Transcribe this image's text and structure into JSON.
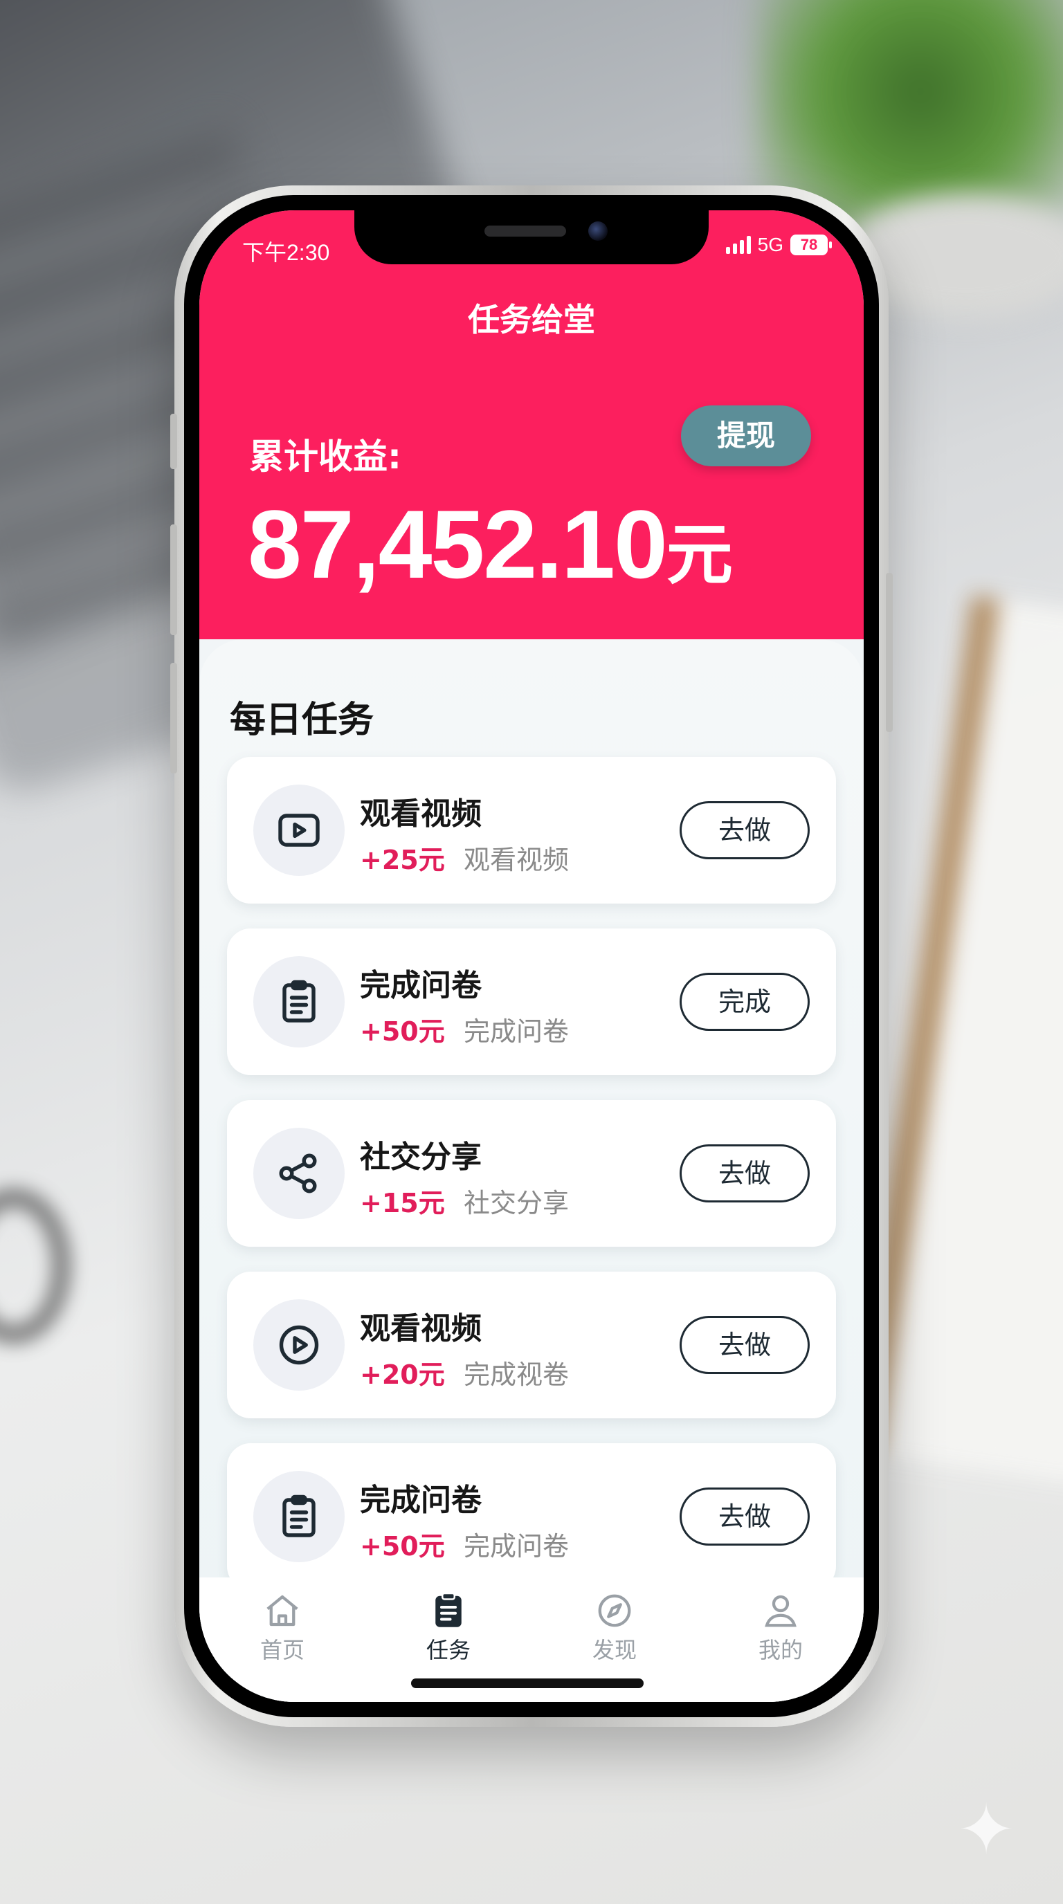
{
  "status_bar": {
    "time": "下午2:30",
    "network": "5G",
    "battery": "78"
  },
  "header": {
    "app_title": "任务给堂",
    "earnings_label": "累计收益:",
    "earnings_value": "87,452.10",
    "earnings_unit": "元",
    "withdraw_label": "提现"
  },
  "section_title": "每日任务",
  "tasks": [
    {
      "icon": "video-icon",
      "title": "观看视频",
      "reward": "+25元",
      "desc": "观看视频",
      "button": "去做"
    },
    {
      "icon": "clipboard-icon",
      "title": "完成问卷",
      "reward": "+50元",
      "desc": "完成问卷",
      "button": "完成"
    },
    {
      "icon": "share-icon",
      "title": "社交分享",
      "reward": "+15元",
      "desc": "社交分享",
      "button": "去做"
    },
    {
      "icon": "play-circle-icon",
      "title": "观看视频",
      "reward": "+20元",
      "desc": "完成视卷",
      "button": "去做"
    },
    {
      "icon": "clipboard-icon",
      "title": "完成问卷",
      "reward": "+50元",
      "desc": "完成问卷",
      "button": "去做"
    }
  ],
  "tabbar": {
    "items": [
      {
        "icon": "home-icon",
        "label": "首页",
        "active": false
      },
      {
        "icon": "task-icon",
        "label": "任务",
        "active": true
      },
      {
        "icon": "compass-icon",
        "label": "发现",
        "active": false
      },
      {
        "icon": "user-icon",
        "label": "我的",
        "active": false
      }
    ]
  },
  "colors": {
    "brand": "#fc1f5e",
    "reward": "#e11d5a",
    "withdraw_button": "#5c8e98",
    "active_tab": "#1e2a33",
    "inactive_tab": "#9aa0a6"
  }
}
